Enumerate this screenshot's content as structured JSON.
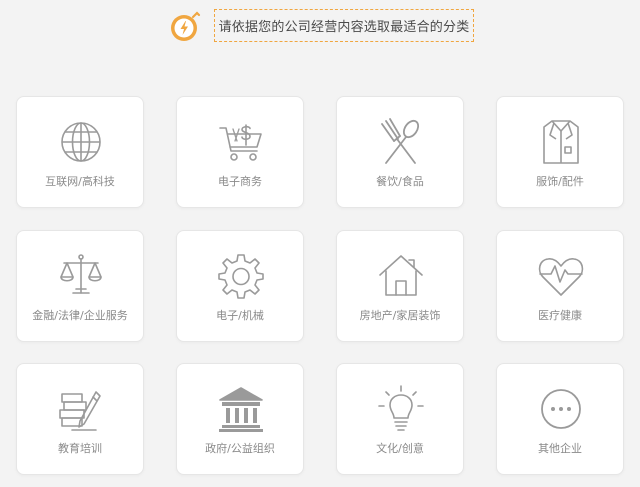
{
  "header": {
    "instruction": "请依据您的公司经营内容选取最适合的分类",
    "icon": "lightning-badge-icon",
    "accent_color": "#f0a640"
  },
  "categories": [
    {
      "label": "互联网/高科技",
      "icon": "globe-icon"
    },
    {
      "label": "电子商务",
      "icon": "shopping-cart-icon"
    },
    {
      "label": "餐饮/食品",
      "icon": "fork-spoon-icon"
    },
    {
      "label": "服饰/配件",
      "icon": "shirt-icon"
    },
    {
      "label": "金融/法律/企业服务",
      "icon": "scales-icon"
    },
    {
      "label": "电子/机械",
      "icon": "gear-icon"
    },
    {
      "label": "房地产/家居装饰",
      "icon": "house-icon"
    },
    {
      "label": "医疗健康",
      "icon": "heartbeat-icon"
    },
    {
      "label": "教育培训",
      "icon": "books-pen-icon"
    },
    {
      "label": "政府/公益组织",
      "icon": "government-building-icon"
    },
    {
      "label": "文化/创意",
      "icon": "light-bulb-icon"
    },
    {
      "label": "其他企业",
      "icon": "more-dots-icon"
    }
  ]
}
